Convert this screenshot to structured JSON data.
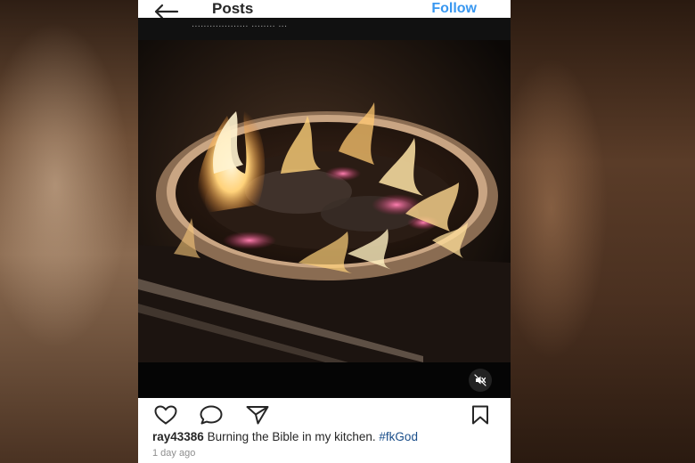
{
  "header": {
    "title": "Posts",
    "follow_label": "Follow"
  },
  "post": {
    "username_partial": "...................  ........  ...",
    "mute_icon": "speaker-muted-icon",
    "caption_user": "ray43386",
    "caption_text": " Burning the Bible in my kitchen. ",
    "caption_tag": "#fkGod",
    "timestamp": "1 day ago"
  },
  "icons": {
    "back": "arrow-left-icon",
    "like": "heart-icon",
    "comment": "comment-bubble-icon",
    "share": "paper-plane-icon",
    "save": "bookmark-icon"
  },
  "colors": {
    "accent": "#3897f0",
    "hashtag": "#1a4e8a",
    "text": "#262626",
    "muted": "#8e8e8e"
  }
}
